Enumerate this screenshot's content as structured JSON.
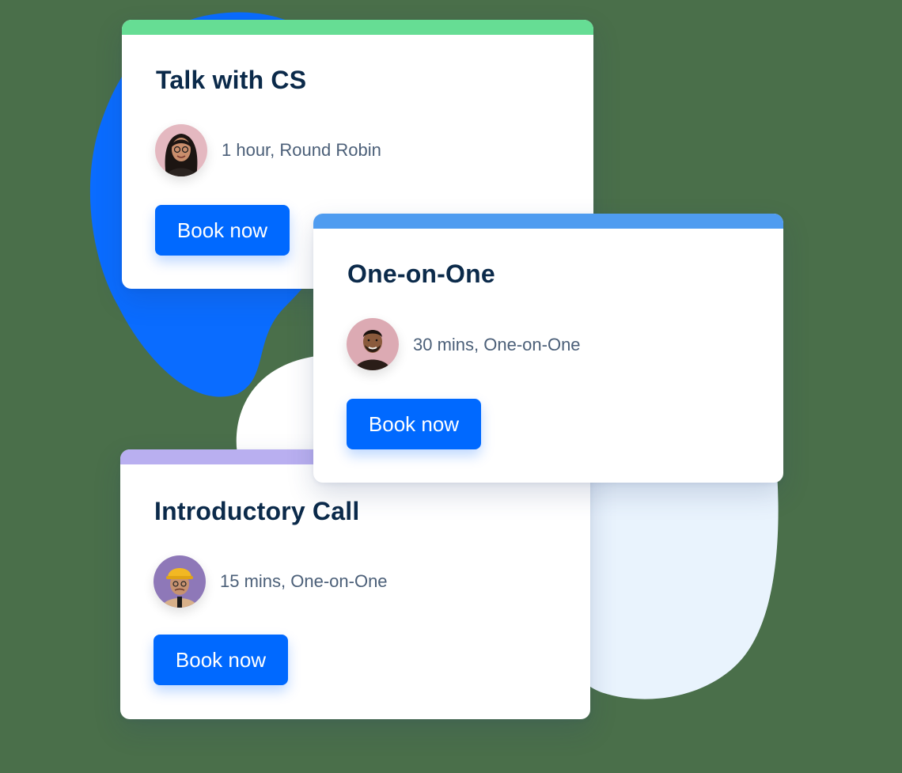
{
  "cards": [
    {
      "id": "talk-with-cs",
      "title": "Talk with CS",
      "meta": "1 hour, Round Robin",
      "button_label": "Book now",
      "accent_color": "#66dd94",
      "avatar_icon": "woman-with-glasses-avatar"
    },
    {
      "id": "introductory-call",
      "title": "Introductory Call",
      "meta": "15 mins, One-on-One",
      "button_label": "Book now",
      "accent_color": "#b9aff0",
      "avatar_icon": "man-with-yellow-hat-avatar"
    },
    {
      "id": "one-on-one",
      "title": "One-on-One",
      "meta": "30 mins, One-on-One",
      "button_label": "Book now",
      "accent_color": "#4f9cf0",
      "avatar_icon": "smiling-man-avatar"
    }
  ],
  "colors": {
    "button": "#0069ff",
    "title_text": "#0b2a4a",
    "meta_text": "#4b5f78",
    "blob_blue": "#0a6cff"
  }
}
